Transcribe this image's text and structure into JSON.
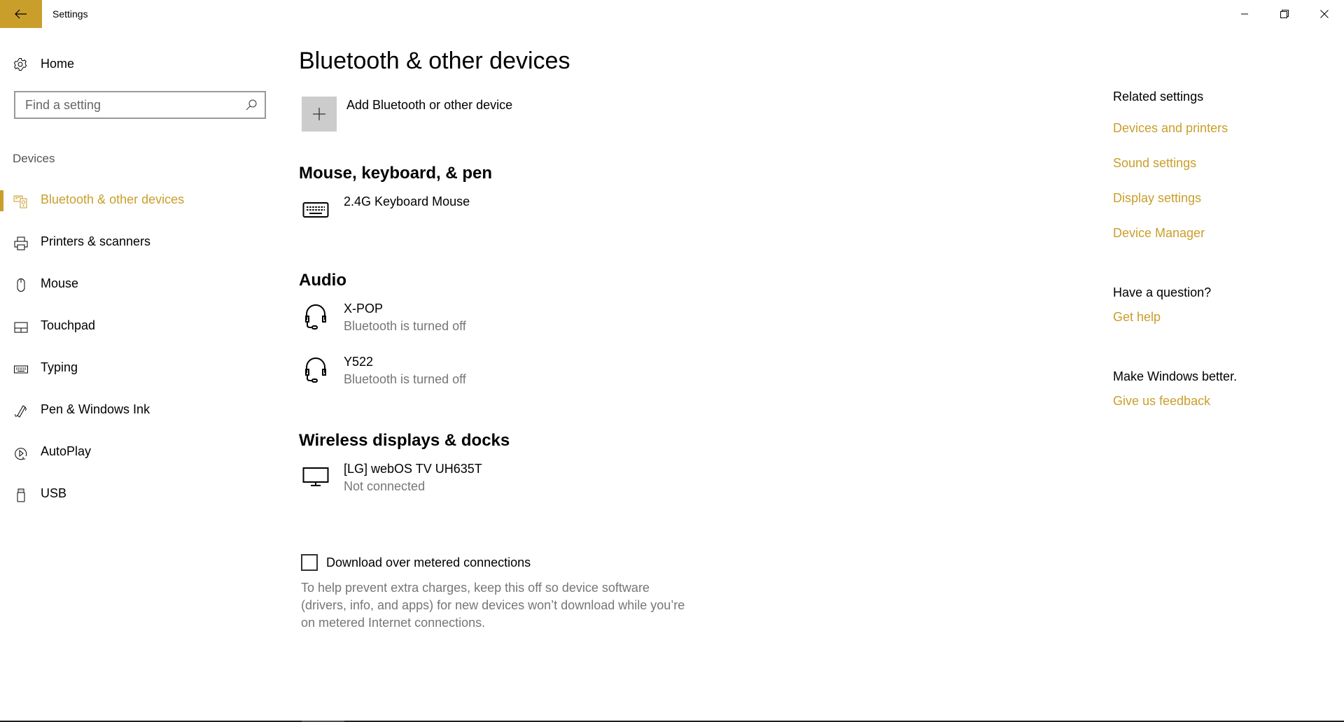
{
  "window": {
    "title": "Settings",
    "controls": {
      "minimize": "minimize",
      "restore": "restore",
      "close": "close"
    }
  },
  "colors": {
    "accent": "#C99E2B",
    "secondary_text": "#767676",
    "add_button_bg": "#CCCCCC"
  },
  "sidebar": {
    "home_label": "Home",
    "search": {
      "value": "",
      "placeholder": "Find a setting"
    },
    "group_label": "Devices",
    "items": [
      {
        "label": "Bluetooth & other devices",
        "icon": "bluetooth-devices-icon",
        "active": true
      },
      {
        "label": "Printers & scanners",
        "icon": "printer-icon",
        "active": false
      },
      {
        "label": "Mouse",
        "icon": "mouse-icon",
        "active": false
      },
      {
        "label": "Touchpad",
        "icon": "touchpad-icon",
        "active": false
      },
      {
        "label": "Typing",
        "icon": "keyboard-icon",
        "active": false
      },
      {
        "label": "Pen & Windows Ink",
        "icon": "pen-icon",
        "active": false
      },
      {
        "label": "AutoPlay",
        "icon": "autoplay-icon",
        "active": false
      },
      {
        "label": "USB",
        "icon": "usb-icon",
        "active": false
      }
    ]
  },
  "main": {
    "title": "Bluetooth & other devices",
    "add_device_label": "Add Bluetooth or other device",
    "sections": {
      "input": {
        "title": "Mouse, keyboard, & pen",
        "devices": [
          {
            "name": "2.4G Keyboard Mouse",
            "status": "",
            "icon": "keyboard-icon"
          }
        ]
      },
      "audio": {
        "title": "Audio",
        "devices": [
          {
            "name": "X-POP",
            "status": "Bluetooth is turned off",
            "icon": "headset-icon"
          },
          {
            "name": "Y522",
            "status": "Bluetooth is turned off",
            "icon": "headset-icon"
          }
        ]
      },
      "displays": {
        "title": "Wireless displays & docks",
        "devices": [
          {
            "name": "[LG] webOS TV UH635T",
            "status": "Not connected",
            "icon": "monitor-icon"
          }
        ]
      }
    },
    "metered": {
      "label": "Download over metered connections",
      "checked": false,
      "description": "To help prevent extra charges, keep this off so device software (drivers, info, and apps) for new devices won’t download while you’re on metered Internet connections."
    }
  },
  "related": {
    "header": "Related settings",
    "links": [
      "Devices and printers",
      "Sound settings",
      "Display settings",
      "Device Manager"
    ],
    "question_header": "Have a question?",
    "help_link": "Get help",
    "feedback_header": "Make Windows better.",
    "feedback_link": "Give us feedback"
  }
}
